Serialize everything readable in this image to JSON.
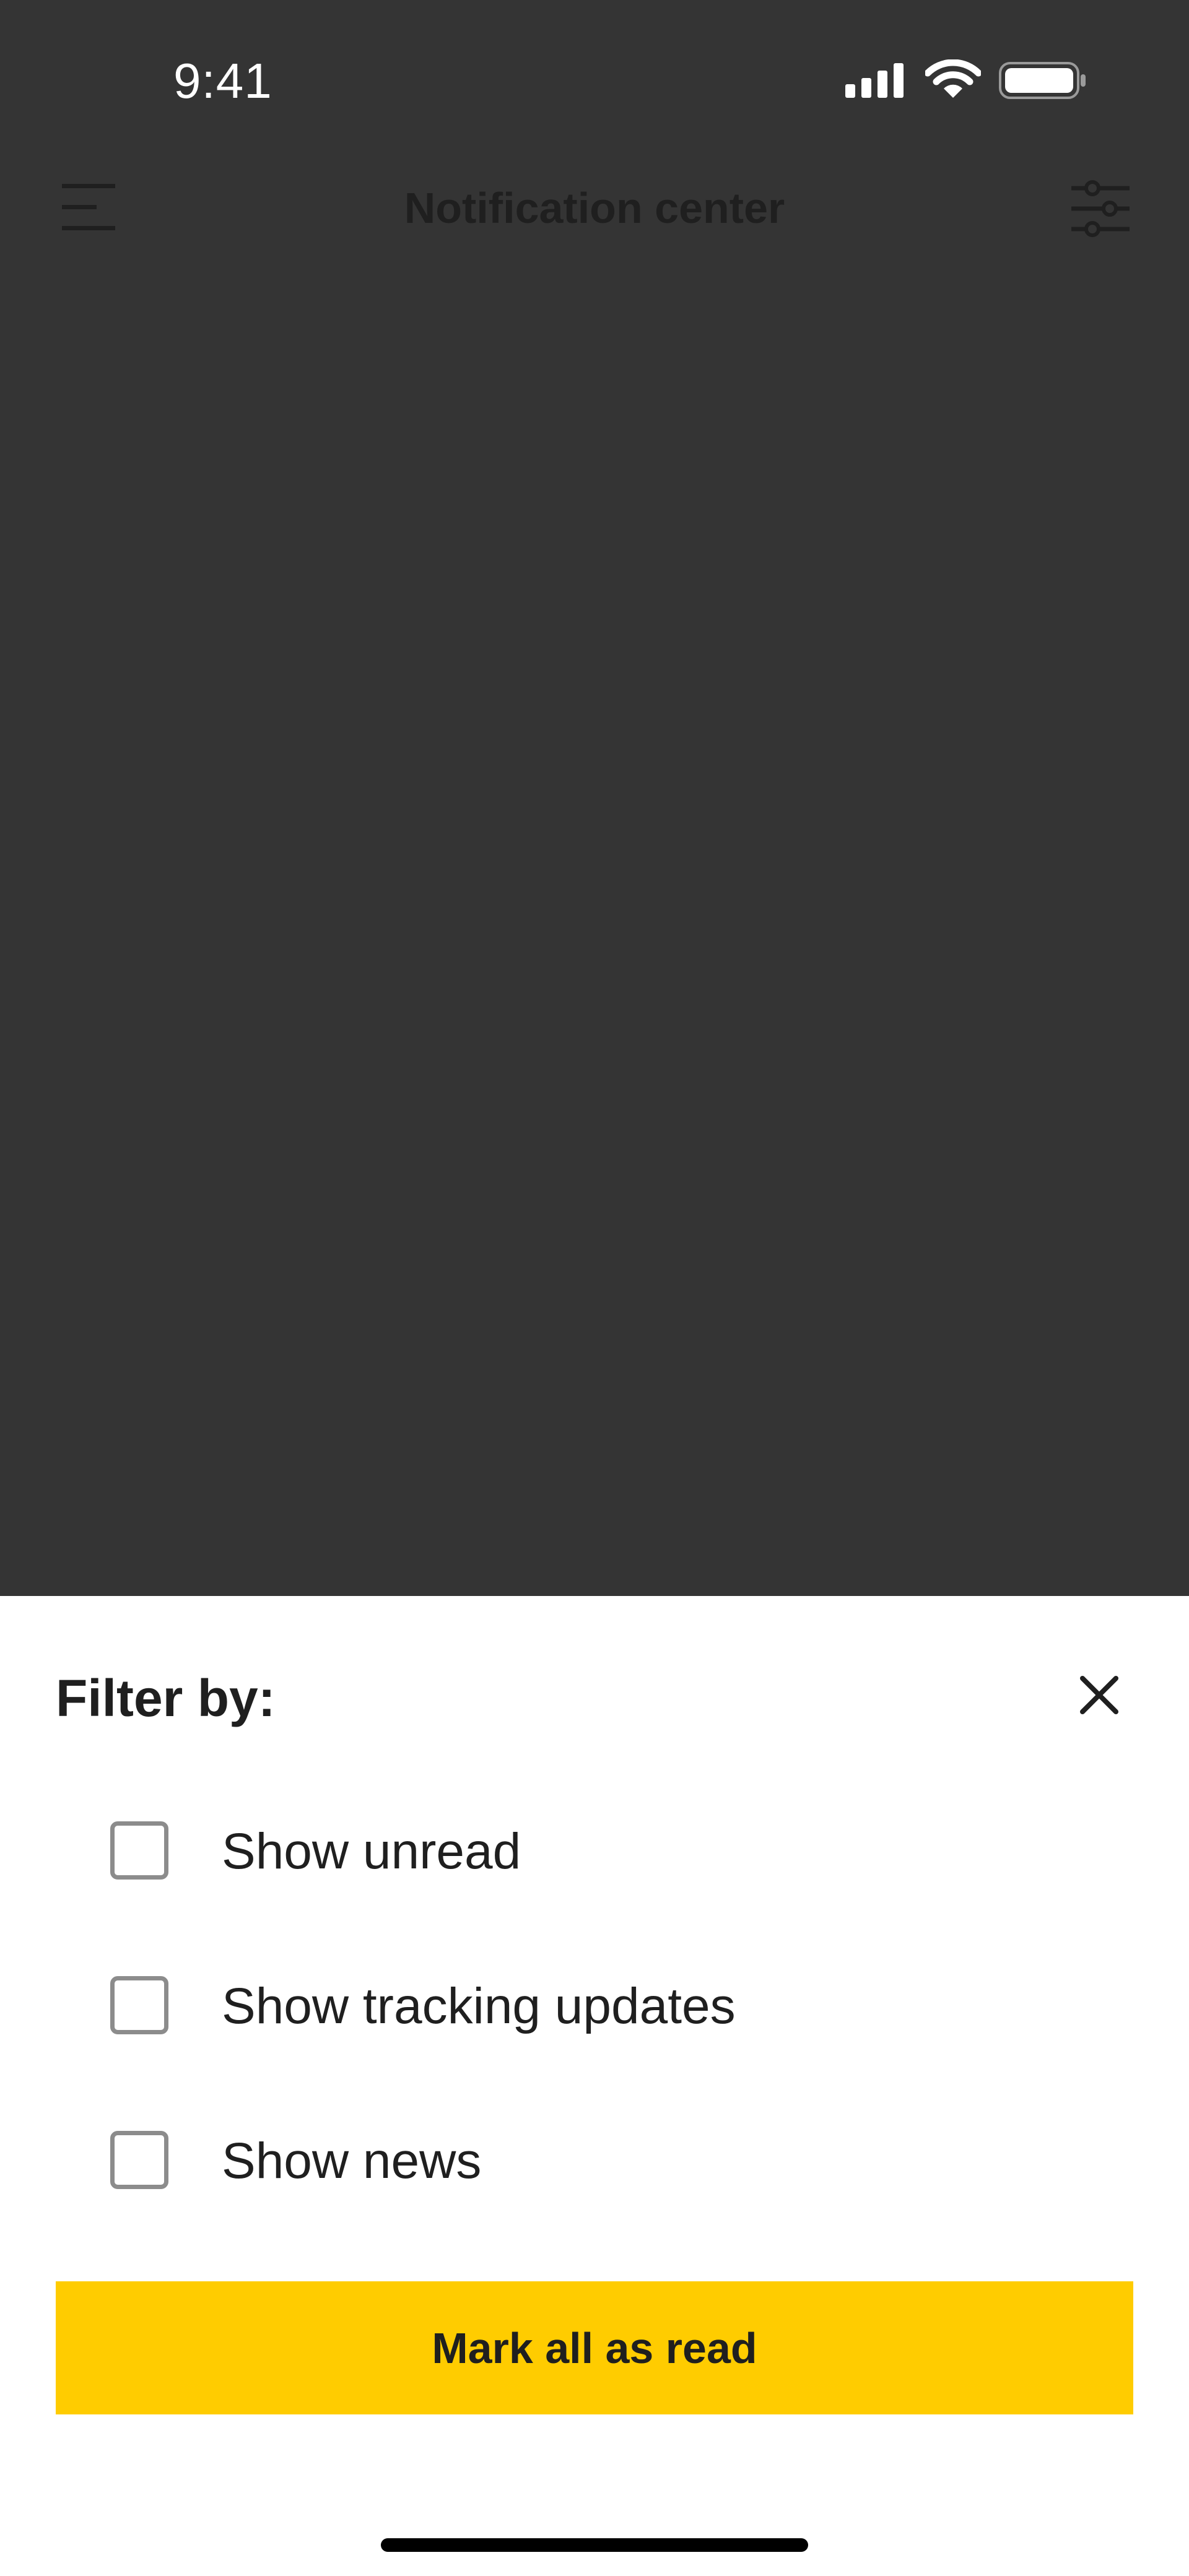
{
  "status_bar": {
    "time": "9:41",
    "signal_icon": "cellular-signal-icon",
    "wifi_icon": "wifi-icon",
    "battery_icon": "battery-icon"
  },
  "header": {
    "title": "Notification center",
    "menu_icon": "hamburger-menu-icon",
    "filter_icon": "sliders-filter-icon"
  },
  "filter_sheet": {
    "title": "Filter by:",
    "close_icon": "close-icon",
    "options": [
      {
        "label": "Show unread",
        "checked": false
      },
      {
        "label": "Show tracking updates",
        "checked": false
      },
      {
        "label": "Show news",
        "checked": false
      }
    ],
    "action_label": "Mark all as read"
  },
  "colors": {
    "overlay": "#343434",
    "accent": "#ffcc00",
    "text": "#1f1f1f",
    "checkbox_border": "#8c8c8c"
  }
}
